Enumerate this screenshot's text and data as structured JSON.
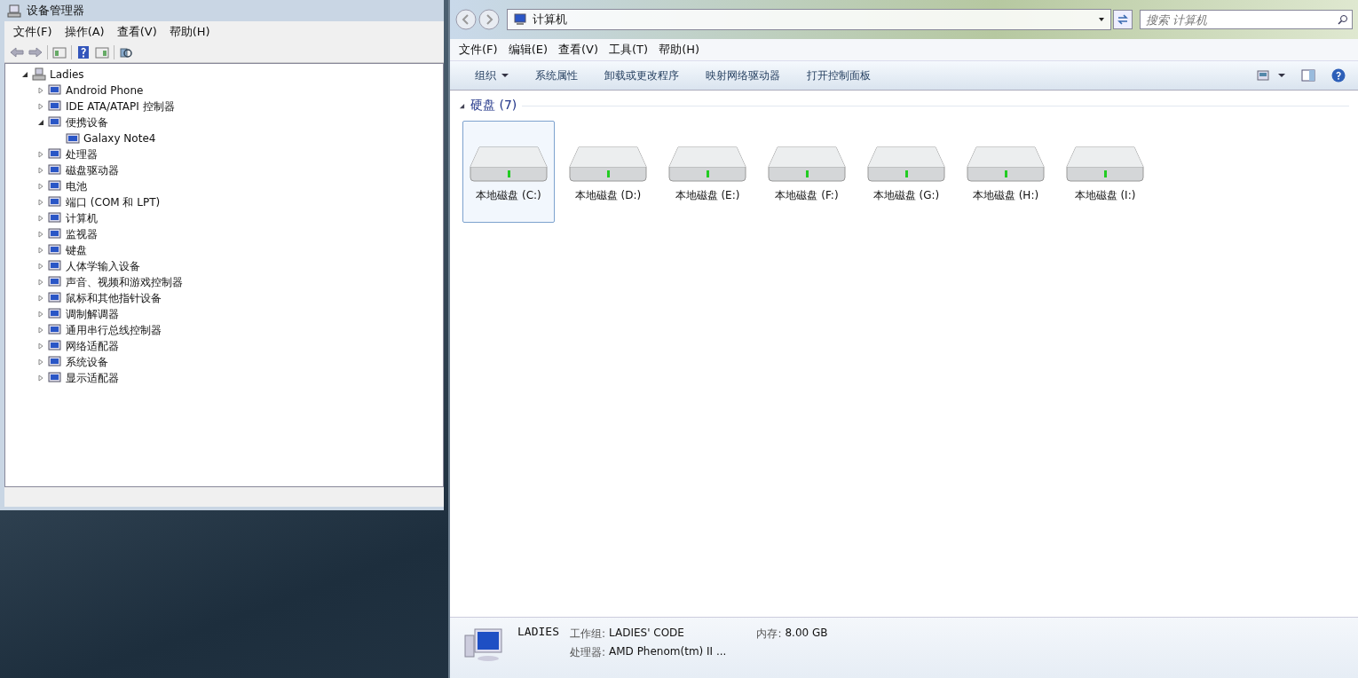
{
  "device_manager": {
    "title": "设备管理器",
    "menu": [
      "文件(F)",
      "操作(A)",
      "查看(V)",
      "帮助(H)"
    ],
    "tree": [
      {
        "label": "Ladies",
        "expanded": true,
        "children": [
          {
            "label": "Android Phone",
            "expanded": false
          },
          {
            "label": "IDE ATA/ATAPI 控制器",
            "expanded": false
          },
          {
            "label": "便携设备",
            "expanded": true,
            "children": [
              {
                "label": "Galaxy Note4"
              }
            ]
          },
          {
            "label": "处理器",
            "expanded": false
          },
          {
            "label": "磁盘驱动器",
            "expanded": false
          },
          {
            "label": "电池",
            "expanded": false
          },
          {
            "label": "端口 (COM 和 LPT)",
            "expanded": false
          },
          {
            "label": "计算机",
            "expanded": false
          },
          {
            "label": "监视器",
            "expanded": false
          },
          {
            "label": "键盘",
            "expanded": false
          },
          {
            "label": "人体学输入设备",
            "expanded": false
          },
          {
            "label": "声音、视频和游戏控制器",
            "expanded": false
          },
          {
            "label": "鼠标和其他指针设备",
            "expanded": false
          },
          {
            "label": "调制解调器",
            "expanded": false
          },
          {
            "label": "通用串行总线控制器",
            "expanded": false
          },
          {
            "label": "网络适配器",
            "expanded": false
          },
          {
            "label": "系统设备",
            "expanded": false
          },
          {
            "label": "显示适配器",
            "expanded": false
          }
        ]
      }
    ]
  },
  "explorer": {
    "breadcrumb": "计算机",
    "search": {
      "placeholder": "搜索 计算机"
    },
    "menu": [
      "文件(F)",
      "编辑(E)",
      "查看(V)",
      "工具(T)",
      "帮助(H)"
    ],
    "toolbar": [
      {
        "label": "组织",
        "dropdown": true
      },
      {
        "label": "系统属性",
        "dropdown": false
      },
      {
        "label": "卸载或更改程序",
        "dropdown": false
      },
      {
        "label": "映射网络驱动器",
        "dropdown": false
      },
      {
        "label": "打开控制面板",
        "dropdown": false
      }
    ],
    "group": "硬盘 (7)",
    "drives": [
      {
        "label": "本地磁盘 (C:)",
        "selected": true
      },
      {
        "label": "本地磁盘 (D:)",
        "selected": false
      },
      {
        "label": "本地磁盘 (E:)",
        "selected": false
      },
      {
        "label": "本地磁盘 (F:)",
        "selected": false
      },
      {
        "label": "本地磁盘 (G:)",
        "selected": false
      },
      {
        "label": "本地磁盘 (H:)",
        "selected": false
      },
      {
        "label": "本地磁盘 (I:)",
        "selected": false
      }
    ],
    "details": {
      "name": "LADIES",
      "workgroup_label": "工作组:",
      "workgroup": "LADIES' CODE",
      "memory_label": "内存:",
      "memory": "8.00 GB",
      "processor_label": "处理器:",
      "processor": "AMD Phenom(tm) II ..."
    }
  }
}
